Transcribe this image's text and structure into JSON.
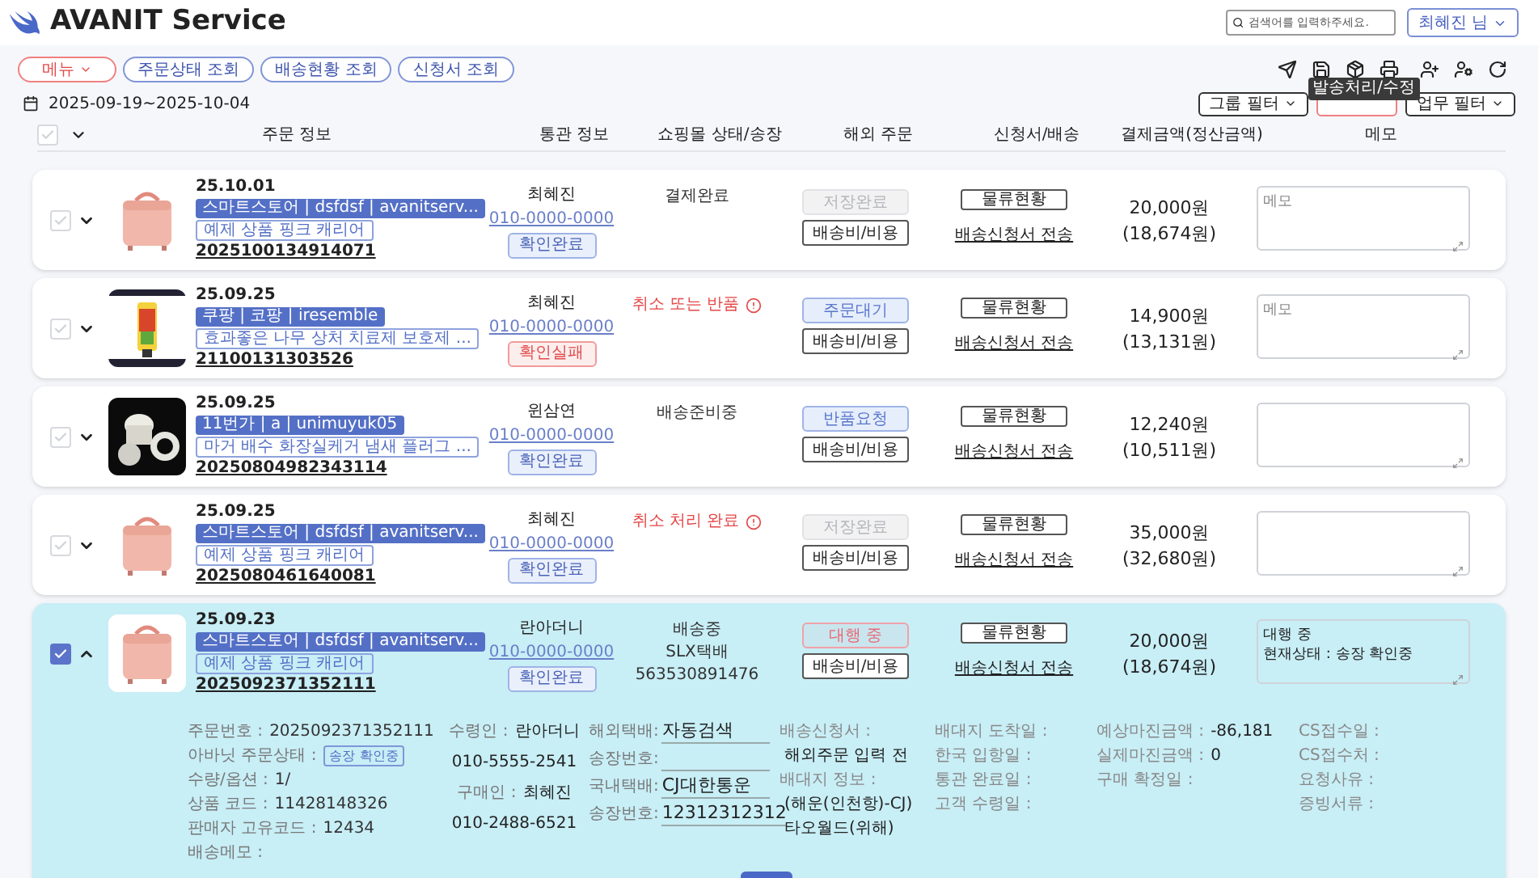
{
  "header": {
    "title": "AVANIT Service",
    "search_placeholder": "검색어를 입력하주세요.",
    "user": "최혜진 님"
  },
  "menu_button": "메뉴",
  "nav_links": [
    "주문상태 조회",
    "배송현황 조회",
    "신청서 조회"
  ],
  "date_range": "2025-09-19~2025-10-04",
  "tooltip": "발송처리/수정",
  "filters": [
    "그룹 필터",
    "업무 필터"
  ],
  "header_checkbox": {
    "checked": false
  },
  "columns": [
    "주문 정보",
    "통관 정보",
    "쇼핑몰 상태/송장",
    "해외 주문",
    "신청서/배송",
    "결제금액(정산금액)",
    "메모"
  ],
  "orders": [
    {
      "checked": false,
      "expanded": false,
      "date": "25.10.01",
      "channel": "스마트스토어 | dsfdsf | avanitserv...",
      "product": "예제 상품 핑크 캐리어",
      "order_no": "2025100134914071",
      "customer": "최혜진",
      "phone": "010-0000-0000",
      "customs": {
        "label": "확인완료",
        "kind": "ok"
      },
      "shop_status": {
        "lines": [
          "결제완료"
        ],
        "alert": false
      },
      "overseas": {
        "label": "저장완료",
        "kind": "saved"
      },
      "fee_button": "배송비/비용",
      "logistics_button": "물류현황",
      "apply_link": "배송신청서 전송",
      "amount": "20,000원",
      "settled": "(18,674원)",
      "memo": {
        "placeholder": "메모"
      }
    },
    {
      "checked": false,
      "expanded": false,
      "date": "25.09.25",
      "channel": "쿠팡 | 코팡 | iresemble",
      "product": "효과좋은 나무 상처 치료제 보호제 ...",
      "order_no": "21100131303526",
      "customer": "최혜진",
      "phone": "010-0000-0000",
      "customs": {
        "label": "확인실패",
        "kind": "fail"
      },
      "shop_status": {
        "lines": [
          "취소 또는 반품"
        ],
        "alert": true
      },
      "overseas": {
        "label": "주문대기",
        "kind": "waiting"
      },
      "fee_button": "배송비/비용",
      "logistics_button": "물류현황",
      "apply_link": "배송신청서 전송",
      "amount": "14,900원",
      "settled": "(13,131원)",
      "memo": {
        "placeholder": "메모"
      }
    },
    {
      "checked": false,
      "expanded": false,
      "date": "25.09.25",
      "channel": "11번가 | a | unimuyuk05",
      "product": "마거 배수 화장실케거 냄새 플러그 ...",
      "order_no": "20250804982343114",
      "customer": "윈삼연",
      "phone": "010-0000-0000",
      "customs": {
        "label": "확인완료",
        "kind": "ok"
      },
      "shop_status": {
        "lines": [
          "배송준비중"
        ],
        "alert": false
      },
      "overseas": {
        "label": "반품요청",
        "kind": "waiting"
      },
      "fee_button": "배송비/비용",
      "logistics_button": "물류현황",
      "apply_link": "배송신청서 전송",
      "amount": "12,240원",
      "settled": "(10,511원)"
    },
    {
      "checked": false,
      "expanded": false,
      "date": "25.09.25",
      "channel": "스마트스토어 | dsfdsf | avanitserv...",
      "product": "예제 상품 핑크 캐리어",
      "order_no": "2025080461640081",
      "customer": "최혜진",
      "phone": "010-0000-0000",
      "customs": {
        "label": "확인완료",
        "kind": "ok"
      },
      "shop_status": {
        "lines": [
          "취소 처리 완료"
        ],
        "alert": true
      },
      "overseas": {
        "label": "저장완료",
        "kind": "saved"
      },
      "fee_button": "배송비/비용",
      "logistics_button": "물류현황",
      "apply_link": "배송신청서 전송",
      "amount": "35,000원",
      "settled": "(32,680원)"
    },
    {
      "checked": true,
      "expanded": true,
      "date": "25.09.23",
      "channel": "스마트스토어 | dsfdsf | avanitserv...",
      "product": "예제 상품 핑크 캐리어",
      "order_no": "2025092371352111",
      "customer": "란아더니",
      "phone": "010-0000-0000",
      "customs": {
        "label": "확인완료",
        "kind": "ok"
      },
      "shop_status": {
        "lines": [
          "배송중",
          "SLX택배",
          "563530891476"
        ],
        "alert": false
      },
      "overseas": {
        "label": "대행 중",
        "kind": "proxy"
      },
      "fee_button": "배송비/비용",
      "logistics_button": "물류현황",
      "apply_link": "배송신청서 전송",
      "amount": "20,000원",
      "settled": "(18,674원)",
      "memo": {
        "value": "대행 중\n현재상태 : 송장 확인중"
      },
      "details": {
        "order_fields": [
          {
            "kind": "text",
            "label": "주문번호 :",
            "value": "2025092371352111"
          },
          {
            "kind": "badge",
            "label": "아바닛 주문상태 :",
            "value": "송장 확인중"
          },
          {
            "kind": "text",
            "label": "수량/옵션 :",
            "value": "1/"
          },
          {
            "kind": "text",
            "label": "상품 코드 :",
            "value": "11428148326"
          },
          {
            "kind": "text",
            "label": "판매자 고유코드 :",
            "value": "12434"
          },
          {
            "label": "배송메모 :"
          }
        ],
        "people": [
          {
            "label": "수령인 :",
            "value": "란아더니"
          },
          {
            "value": "010-5555-2541"
          },
          {
            "label": "구매인 :",
            "value": "최혜진"
          },
          {
            "value": "010-2488-6521"
          }
        ],
        "courier_fields": [
          {
            "label": "해외택배:",
            "value": "자동검색"
          },
          {
            "label": "송장번호:"
          },
          {
            "label": "국내택배:",
            "value": "CJ대한통운"
          },
          {
            "label": "송장번호:",
            "value": "12312312312"
          }
        ],
        "application": [
          {
            "kind": "label",
            "text": "배송신청서 :"
          },
          {
            "kind": "value",
            "text": "해외주문 입력 전"
          },
          {
            "kind": "label",
            "text": "배대지 정보 :"
          },
          {
            "kind": "value",
            "text": "(해운(인천항)-CJ)"
          },
          {
            "kind": "value",
            "text": "타오월드(위해)"
          }
        ],
        "info_columns": [
          [
            {
              "label": "배대지 도착일 :"
            },
            {
              "label": "한국 입항일 :"
            },
            {
              "label": "통관 완료일 :"
            },
            {
              "label": "고객 수령일 :"
            }
          ],
          [
            {
              "label": "예상마진금액 :",
              "value": "-86,181"
            },
            {
              "label": "실제마진금액 :",
              "value": "0"
            },
            {
              "label": "구매 확정일 :"
            }
          ],
          [
            {
              "label": "CS접수일 :"
            },
            {
              "label": "CS접수처 :"
            },
            {
              "label": "요청사유 :"
            },
            {
              "label": "증빙서류 :"
            }
          ]
        ]
      }
    }
  ]
}
